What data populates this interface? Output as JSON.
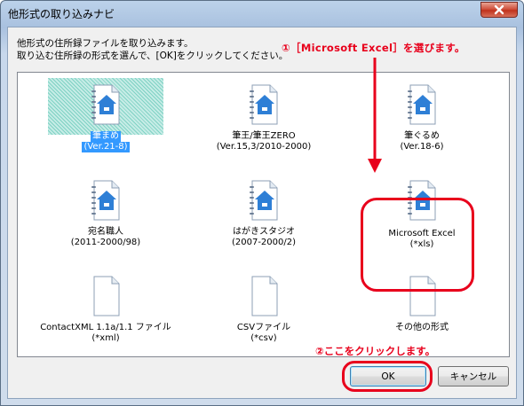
{
  "window": {
    "title": "他形式の取り込みナビ",
    "close_icon": "close-icon"
  },
  "instructions": {
    "line1": "他形式の住所録ファイルを取り込みます。",
    "line2": "取り込む住所録の形式を選んで、[OK]をクリックしてください。"
  },
  "annotations": {
    "step1": "①［Microsoft Excel］を選びます。",
    "step2": "②ここをクリックします。",
    "color": "#e8001c"
  },
  "formats": [
    {
      "name": "筆まめ",
      "version": "(Ver.21-8)",
      "icon": "address-book-icon",
      "selected": true
    },
    {
      "name": "筆王/筆王ZERO",
      "version": "(Ver.15,3/2010-2000)",
      "icon": "address-book-icon",
      "selected": false
    },
    {
      "name": "筆ぐるめ",
      "version": "(Ver.18-6)",
      "icon": "address-book-icon",
      "selected": false
    },
    {
      "name": "宛名職人",
      "version": "(2011-2000/98)",
      "icon": "address-book-icon",
      "selected": false
    },
    {
      "name": "はがきスタジオ",
      "version": "(2007-2000/2)",
      "icon": "address-book-icon",
      "selected": false
    },
    {
      "name": "Microsoft Excel",
      "version": "(*xls)",
      "icon": "address-book-icon",
      "selected": false
    },
    {
      "name": "ContactXML 1.1a/1.1 ファイル",
      "version": "(*xml)",
      "icon": "blank-file-icon",
      "selected": false
    },
    {
      "name": "CSVファイル",
      "version": "(*csv)",
      "icon": "blank-file-icon",
      "selected": false
    },
    {
      "name": "その他の形式",
      "version": "",
      "icon": "blank-file-icon",
      "selected": false
    }
  ],
  "buttons": {
    "ok": "OK",
    "cancel": "キャンセル"
  }
}
